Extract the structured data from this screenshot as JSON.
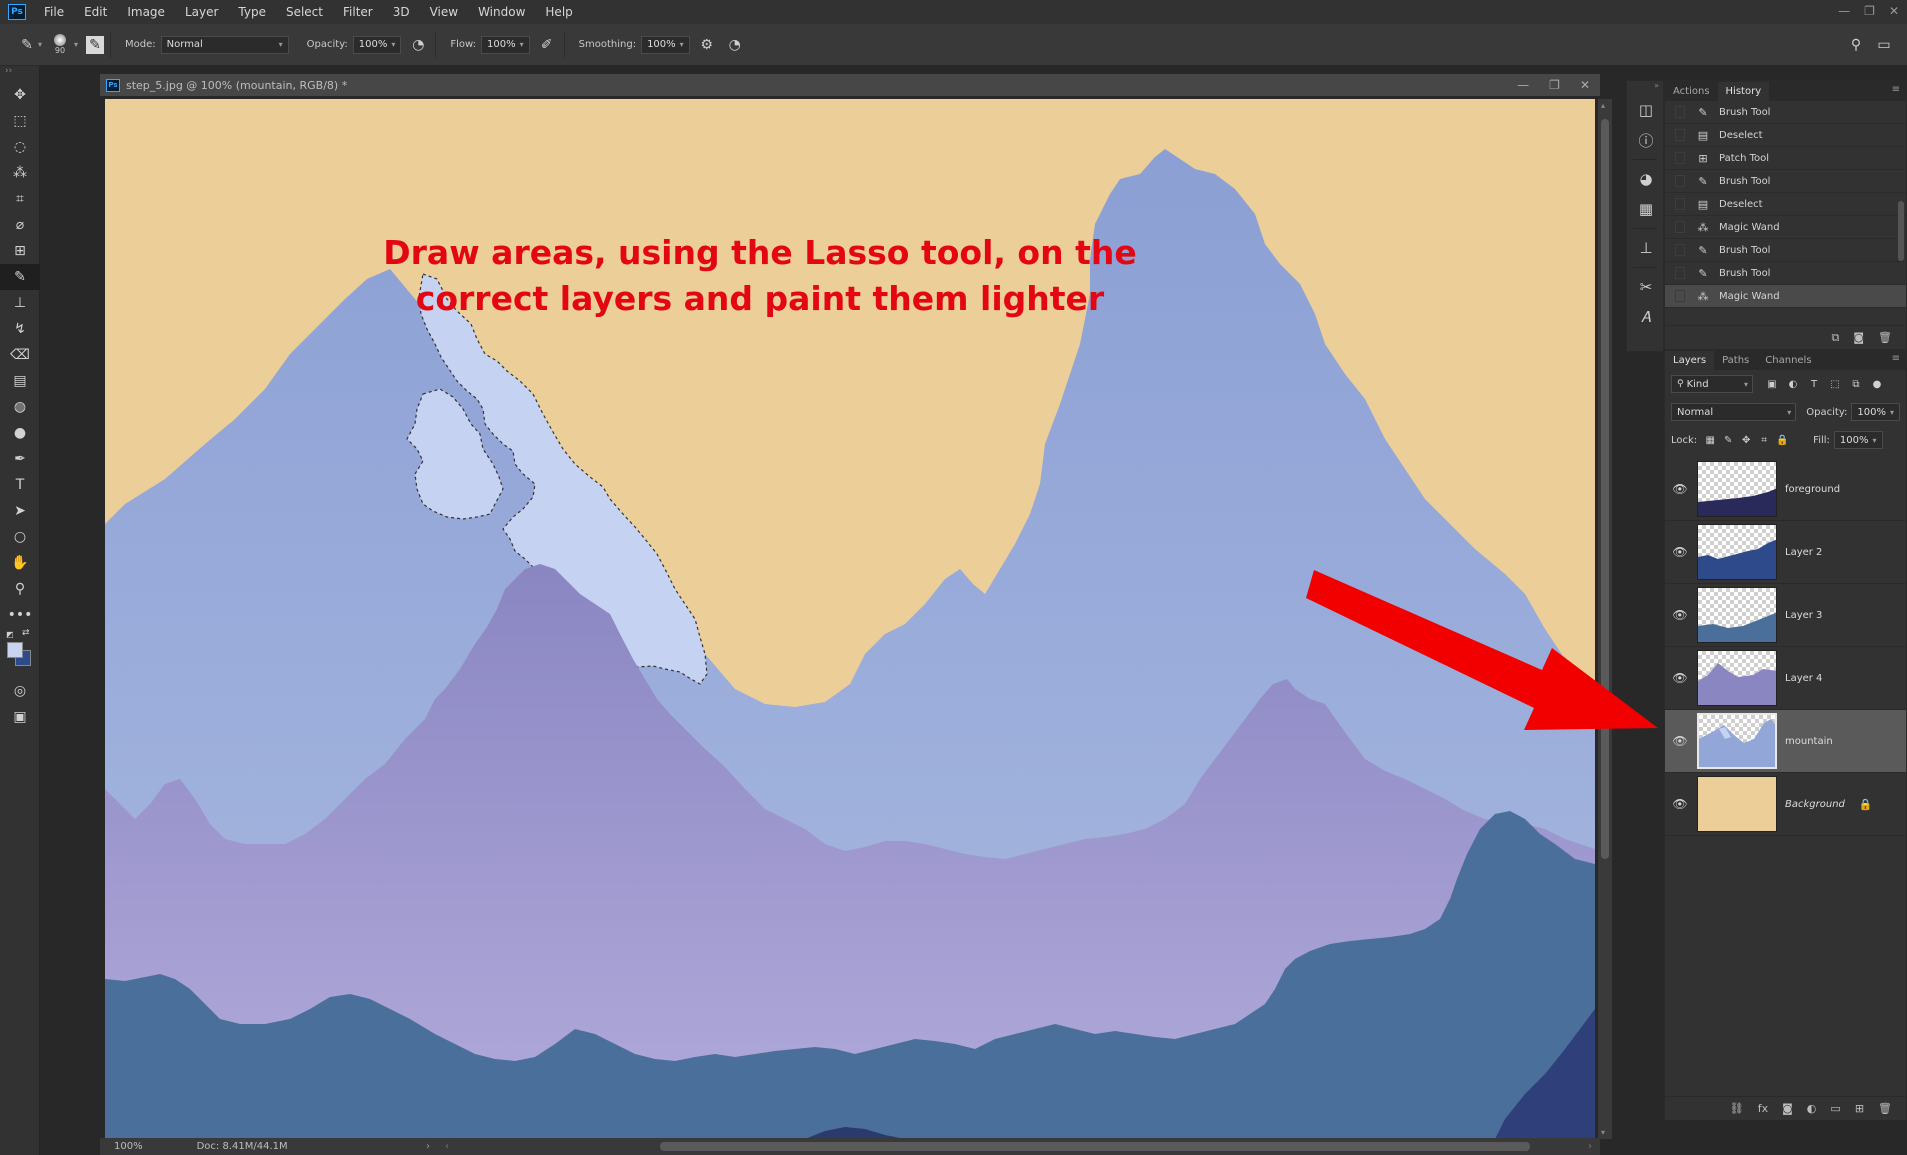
{
  "menubar": {
    "logo": "Ps",
    "items": [
      "File",
      "Edit",
      "Image",
      "Layer",
      "Type",
      "Select",
      "Filter",
      "3D",
      "View",
      "Window",
      "Help"
    ],
    "win_min": "—",
    "win_max": "❐",
    "win_close": "✕"
  },
  "options": {
    "brush_size": "90",
    "mode_label": "Mode:",
    "mode_value": "Normal",
    "opacity_label": "Opacity:",
    "opacity_value": "100%",
    "flow_label": "Flow:",
    "flow_value": "100%",
    "smoothing_label": "Smoothing:",
    "smoothing_value": "100%"
  },
  "toolbar": {
    "tools": [
      {
        "name": "move-tool-icon",
        "glyph": "✥"
      },
      {
        "name": "marquee-tool-icon",
        "glyph": "⬚"
      },
      {
        "name": "lasso-tool-icon",
        "glyph": "◌"
      },
      {
        "name": "magic-wand-tool-icon",
        "glyph": "⁂"
      },
      {
        "name": "crop-tool-icon",
        "glyph": "⌗"
      },
      {
        "name": "eyedropper-tool-icon",
        "glyph": "⌀"
      },
      {
        "name": "patch-tool-icon",
        "glyph": "⊞"
      },
      {
        "name": "brush-tool-icon",
        "glyph": "✎",
        "active": true
      },
      {
        "name": "stamp-tool-icon",
        "glyph": "⊥"
      },
      {
        "name": "history-brush-tool-icon",
        "glyph": "↯"
      },
      {
        "name": "eraser-tool-icon",
        "glyph": "⌫"
      },
      {
        "name": "gradient-tool-icon",
        "glyph": "▤"
      },
      {
        "name": "blur-tool-icon",
        "glyph": "◍"
      },
      {
        "name": "dodge-tool-icon",
        "glyph": "●"
      },
      {
        "name": "pen-tool-icon",
        "glyph": "✒"
      },
      {
        "name": "type-tool-icon",
        "glyph": "T"
      },
      {
        "name": "path-selection-tool-icon",
        "glyph": "➤"
      },
      {
        "name": "ellipse-tool-icon",
        "glyph": "○"
      },
      {
        "name": "hand-tool-icon",
        "glyph": "✋"
      },
      {
        "name": "zoom-tool-icon",
        "glyph": "⚲"
      },
      {
        "name": "more-tools-icon",
        "glyph": "•••"
      }
    ],
    "colors": {
      "foreground": "#c8d4f0",
      "background": "#2e4a8a"
    }
  },
  "document": {
    "title": "step_5.jpg @ 100% (mountain, RGB/8) *",
    "annotation_line1": "Draw areas, using the Lasso tool, on the",
    "annotation_line2": "correct layers and paint them lighter",
    "annotation_color": "#e30613"
  },
  "status": {
    "zoom": "100%",
    "doc_size": "Doc: 8.41M/44.1M"
  },
  "history": {
    "tabs": [
      "Actions",
      "History"
    ],
    "active_tab": "History",
    "items": [
      {
        "label": "Brush Tool",
        "icon": "brush-icon"
      },
      {
        "label": "Deselect",
        "icon": "document-icon"
      },
      {
        "label": "Patch Tool",
        "icon": "patch-icon"
      },
      {
        "label": "Brush Tool",
        "icon": "brush-icon"
      },
      {
        "label": "Deselect",
        "icon": "document-icon"
      },
      {
        "label": "Magic Wand",
        "icon": "magic-wand-icon"
      },
      {
        "label": "Brush Tool",
        "icon": "brush-icon"
      },
      {
        "label": "Brush Tool",
        "icon": "brush-icon"
      },
      {
        "label": "Magic Wand",
        "icon": "magic-wand-icon",
        "current": true
      }
    ]
  },
  "layers": {
    "tabs": [
      "Layers",
      "Paths",
      "Channels"
    ],
    "active_tab": "Layers",
    "filter_kind": "Kind",
    "blend_mode": "Normal",
    "opacity_label": "Opacity:",
    "opacity_value": "100%",
    "lock_label": "Lock:",
    "fill_label": "Fill:",
    "fill_value": "100%",
    "items": [
      {
        "name": "foreground",
        "thumb": "foreground"
      },
      {
        "name": "Layer 2",
        "thumb": "layer2"
      },
      {
        "name": "Layer 3",
        "thumb": "layer3"
      },
      {
        "name": "Layer 4",
        "thumb": "layer4"
      },
      {
        "name": "mountain",
        "thumb": "mountain",
        "selected": true
      },
      {
        "name": "Background",
        "thumb": "background",
        "locked": true
      }
    ]
  }
}
